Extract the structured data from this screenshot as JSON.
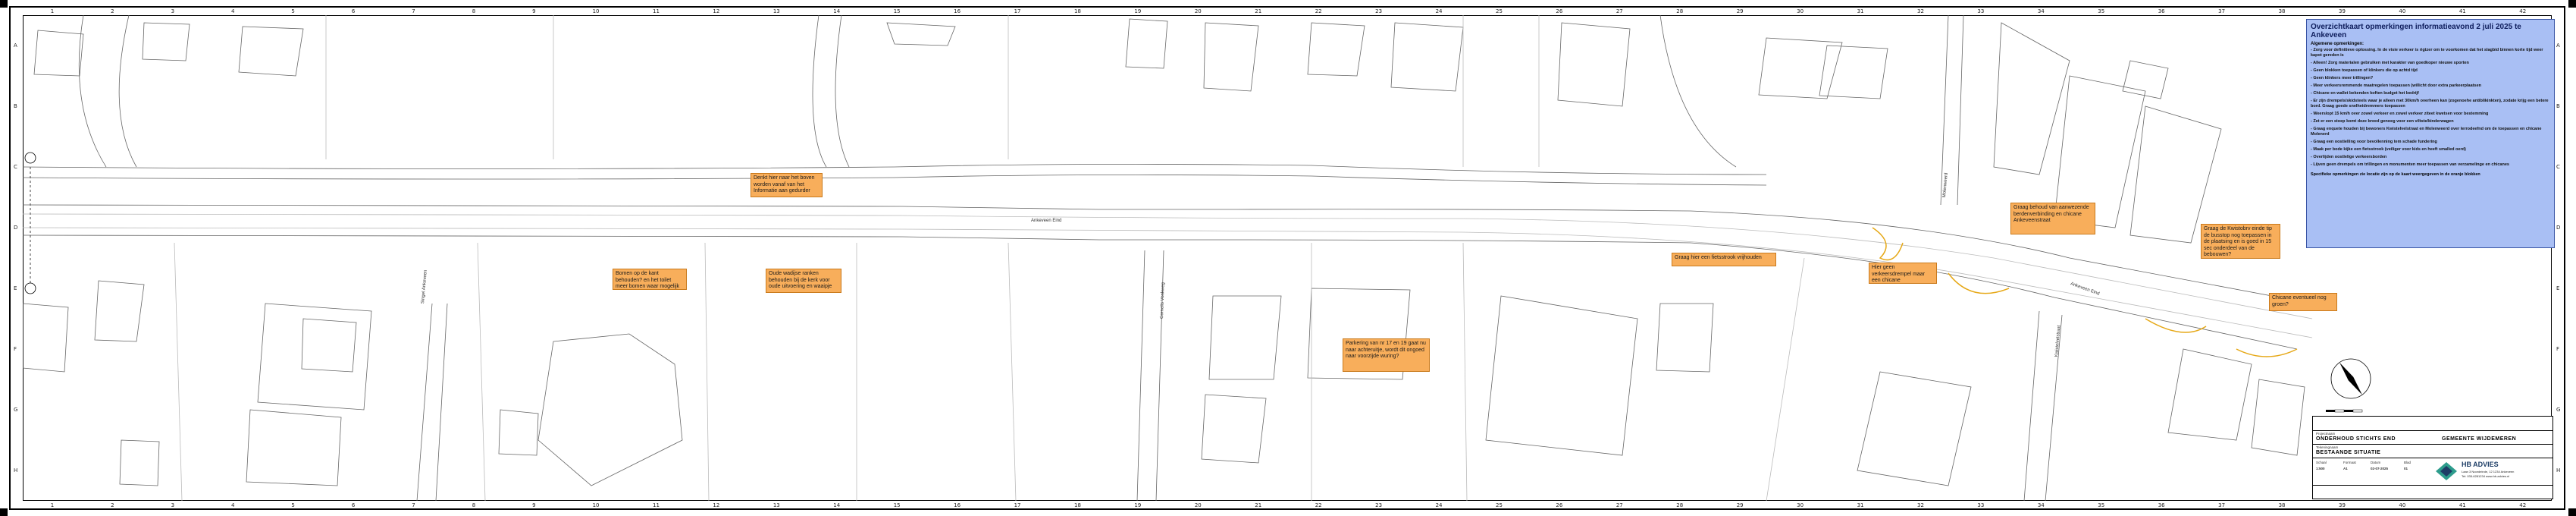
{
  "legend": {
    "title": "Overzichtkaart opmerkingen informatieavond 2 juli 2025 te Ankeveen",
    "subtitle": "Algemene opmerkingen:",
    "items": [
      "- Zorg voor definitieve oplossing. In de visie verkeer is rigtzer om te voorkomen dat het slagbid binnen korte tijd weer kapot gereden is",
      "- Alleen! Zorg materialen gebruiken met karakter van goedkoper nieuwe sporten",
      "- Geen blokken toepassen of klinkers die op achtd tijd",
      "- Geen klinkers meer trillingen?",
      "- Meer verkeersremmende maatregelen toepassen (willicht door extra parkeerplaatsen",
      "- Chicane en wallet bekenden koften budget het bedrijf",
      "- Er zijn drempels/skidsteels waar je alleen met 30km/h overheen kan (zogenoehe antiblikinkten), zodate krijg een betere bord. Graag goede snelheidremmers toepassen",
      "- Weerslopt 15 km/h over zowel verkeer en zowel verkeer ziteet kwetsen voor bestemming",
      "- Zet er een stoep komt deze breed genoeg voor een viltste/kinderwagen",
      "- Graag enquete houden bij bewoners Kwistelvelstraat en Molenweerd over Ierrodeefnd om de toepassen en chicane Molenerd",
      "- Graag een oostielling voor bevollenning tem schade fundering",
      "- Maak per bode kijke een fietsstrook (veiliger voor kids en heeft smalled oerd)",
      "- Overlijden oostlelige verkeersborden",
      "- Lijven geen drempels om trillingen en monumenten meer toepassen van verzamelinge en chicanes"
    ],
    "footer": "Specifieke opmerkingen zie locatie zijn op de kaart weergegeven in de oranje blokken"
  },
  "notes": [
    {
      "id": "note-1",
      "text": "Denkt hier naar het boven worden vanaf van het Informatie aan gedurder"
    },
    {
      "id": "note-2",
      "text": "Bomen op de kant behouden? en het toilet meer bomen waar mogelijk"
    },
    {
      "id": "note-3",
      "text": "Oude wadijse ranken behouden bij de kerk voor oude uitvoering en waaipje"
    },
    {
      "id": "note-4",
      "text": "Parkering van nr 17 en 19 gaat nu naar achteruitje, wordt dit ongoed naar voorzijde wuring?"
    },
    {
      "id": "note-5",
      "text": "Graag hier een fietsstrook vrijhouden"
    },
    {
      "id": "note-6",
      "text": "Hier geen verkeersdrempel maar een chicane"
    },
    {
      "id": "note-7",
      "text": "Graag behoud van aanwezende berdenverbinding en chicane Ankeveenstraat"
    },
    {
      "id": "note-8",
      "text": "Graag de Kwistobrv einde tip de busstop nog toepassen in de plaatsing en is goed in 15 sec onderdeel van de bebouwen?"
    },
    {
      "id": "note-9",
      "text": "Chicane eventueel nog groen?"
    }
  ],
  "roads": {
    "main_top": "Ankeveen Eind",
    "main_right": "Ankeveen Eind",
    "side_left": "Singel Ankeveen",
    "side_mid": "Cornelis Vonkweg",
    "side_right": "Molenweerd",
    "side_right_lower": "Kwistelvelstraat"
  },
  "titleblock": {
    "project_label": "Projectnaam",
    "project": "ONDERHOUD STICHTS END",
    "drawing_label": "Tekeningnaam",
    "drawing": "BESTAANDE SITUATIE",
    "status": "GEMEENTE WIJDEMEREN",
    "company": "HB ADVIES",
    "address_1": "Laan 3 Noordeinde, 12 1234 Ankeveen",
    "address_2": "Tel: 035-6281234  www.hb-advies.nl",
    "scale_label": "Schaal",
    "scale": "1:500",
    "format_label": "Formaat",
    "format": "A1",
    "date_label": "Datum",
    "date": "02-07-2025",
    "sheet_label": "Blad",
    "sheet": "01"
  },
  "grid_numbers_top": [
    "1",
    "2",
    "3",
    "4",
    "5",
    "6",
    "7",
    "8",
    "9",
    "10",
    "11",
    "12",
    "13",
    "14",
    "15",
    "16",
    "17",
    "18",
    "19",
    "20",
    "21",
    "22",
    "23",
    "24",
    "25",
    "26",
    "27",
    "28",
    "29",
    "30",
    "31",
    "32",
    "33",
    "34",
    "35",
    "36",
    "37",
    "38",
    "39",
    "40",
    "41",
    "42"
  ],
  "grid_letters_side": [
    "A",
    "B",
    "C",
    "D",
    "E",
    "F",
    "G",
    "H"
  ],
  "colors": {
    "note_fill": "#f8ae5b",
    "legend_fill": "#a9bff4",
    "line": "#555555",
    "cable": "#e6a817"
  }
}
